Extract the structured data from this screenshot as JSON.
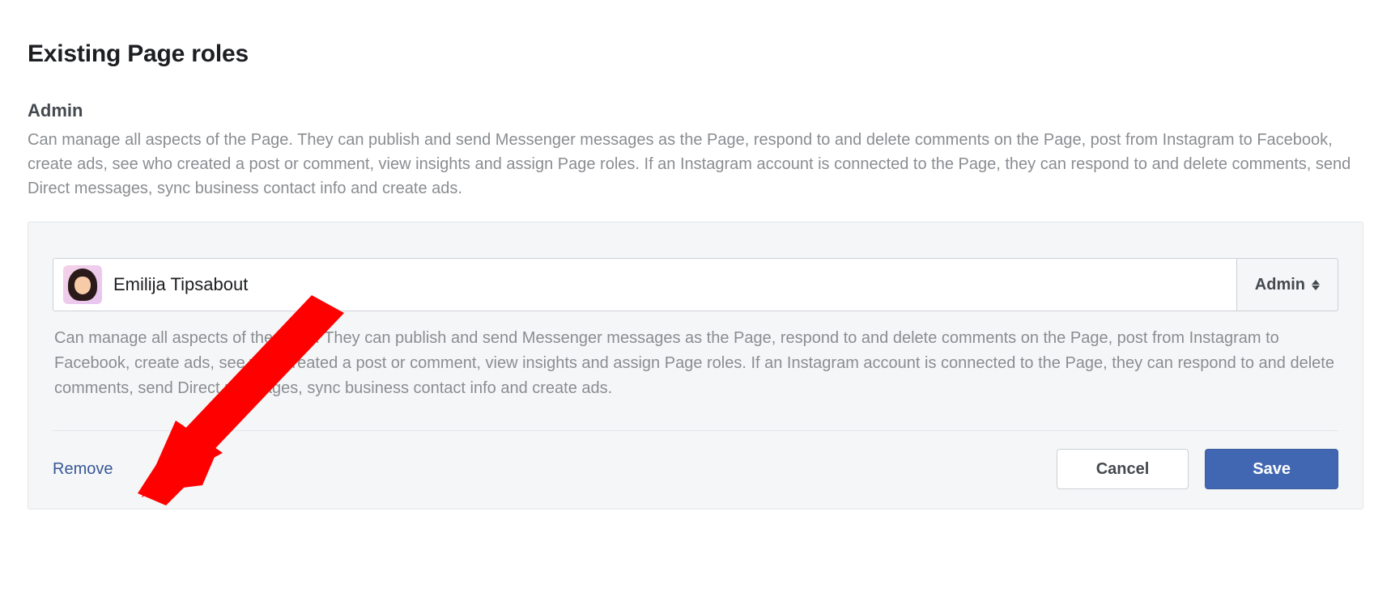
{
  "section": {
    "title": "Existing Page roles"
  },
  "role": {
    "name": "Admin",
    "description": "Can manage all aspects of the Page. They can publish and send Messenger messages as the Page, respond to and delete comments on the Page, post from Instagram to Facebook, create ads, see who created a post or comment, view insights and assign Page roles. If an Instagram account is connected to the Page, they can respond to and delete comments, send Direct messages, sync business contact info and create ads."
  },
  "user": {
    "name": "Emilija Tipsabout",
    "role_selected": "Admin",
    "role_description": "Can manage all aspects of the Page. They can publish and send Messenger messages as the Page, respond to and delete comments on the Page, post from Instagram to Facebook, create ads, see who created a post or comment, view insights and assign Page roles. If an Instagram account is connected to the Page, they can respond to and delete comments, send Direct messages, sync business contact info and create ads."
  },
  "actions": {
    "remove": "Remove",
    "cancel": "Cancel",
    "save": "Save"
  },
  "annotation": {
    "color": "#ff0000"
  }
}
